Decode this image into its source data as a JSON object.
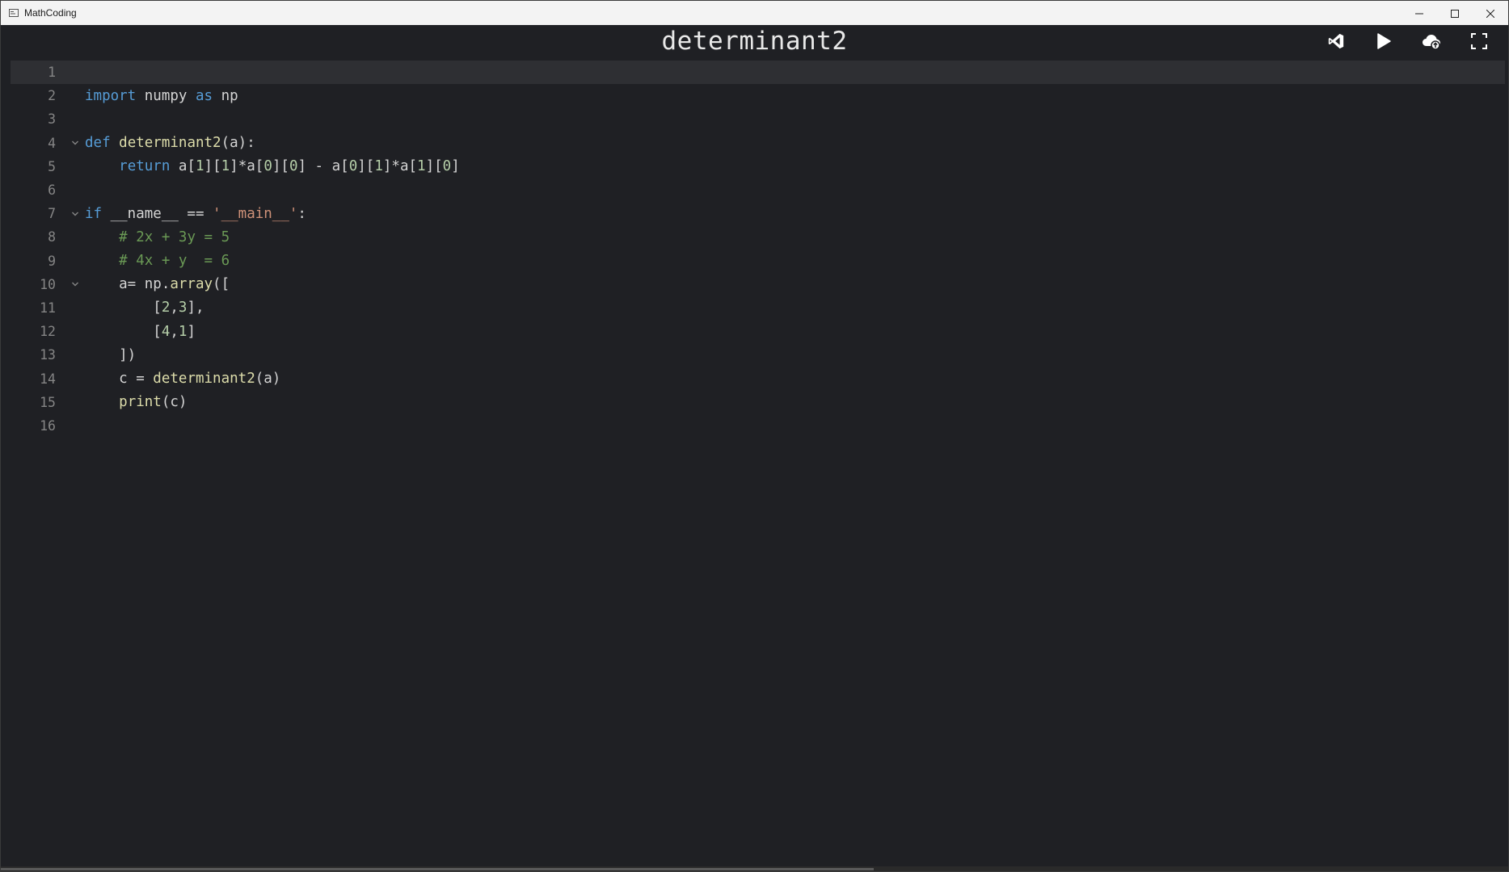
{
  "window": {
    "app_title": "MathCoding",
    "controls": [
      "minimize-icon",
      "maximize-icon",
      "close-icon"
    ]
  },
  "header": {
    "doc_title": "determinant2",
    "tools": [
      {
        "name": "visual-studio-button",
        "icon": "visual-studio-icon"
      },
      {
        "name": "run-button",
        "icon": "play-icon"
      },
      {
        "name": "cloud-upload-button",
        "icon": "cloud-upload-icon"
      },
      {
        "name": "fullscreen-button",
        "icon": "fullscreen-icon"
      }
    ]
  },
  "editor": {
    "active_line": 1,
    "lines": [
      {
        "n": "1",
        "fold": false,
        "tokens": []
      },
      {
        "n": "2",
        "fold": false,
        "tokens": [
          [
            "kw",
            "import"
          ],
          [
            "t",
            " numpy "
          ],
          [
            "kw",
            "as"
          ],
          [
            "t",
            " np"
          ]
        ]
      },
      {
        "n": "3",
        "fold": false,
        "tokens": []
      },
      {
        "n": "4",
        "fold": true,
        "tokens": [
          [
            "kw",
            "def"
          ],
          [
            "t",
            " "
          ],
          [
            "fn",
            "determinant2"
          ],
          [
            "t",
            "(a):"
          ]
        ]
      },
      {
        "n": "5",
        "fold": false,
        "tokens": [
          [
            "t",
            "    "
          ],
          [
            "kw",
            "return"
          ],
          [
            "t",
            " a["
          ],
          [
            "num",
            "1"
          ],
          [
            "t",
            "]["
          ],
          [
            "num",
            "1"
          ],
          [
            "t",
            "]*a["
          ],
          [
            "num",
            "0"
          ],
          [
            "t",
            "]["
          ],
          [
            "num",
            "0"
          ],
          [
            "t",
            "] - a["
          ],
          [
            "num",
            "0"
          ],
          [
            "t",
            "]["
          ],
          [
            "num",
            "1"
          ],
          [
            "t",
            "]*a["
          ],
          [
            "num",
            "1"
          ],
          [
            "t",
            "]["
          ],
          [
            "num",
            "0"
          ],
          [
            "t",
            "]"
          ]
        ]
      },
      {
        "n": "6",
        "fold": false,
        "tokens": []
      },
      {
        "n": "7",
        "fold": true,
        "tokens": [
          [
            "kw",
            "if"
          ],
          [
            "t",
            " __name__ == "
          ],
          [
            "str",
            "'__main__'"
          ],
          [
            "t",
            ":"
          ]
        ]
      },
      {
        "n": "8",
        "fold": false,
        "tokens": [
          [
            "t",
            "    "
          ],
          [
            "cm",
            "# 2x + 3y = 5"
          ]
        ]
      },
      {
        "n": "9",
        "fold": false,
        "tokens": [
          [
            "t",
            "    "
          ],
          [
            "cm",
            "# 4x + y  = 6"
          ]
        ]
      },
      {
        "n": "10",
        "fold": true,
        "tokens": [
          [
            "t",
            "    a= np."
          ],
          [
            "fn",
            "array"
          ],
          [
            "t",
            "(["
          ]
        ]
      },
      {
        "n": "11",
        "fold": false,
        "tokens": [
          [
            "t",
            "        ["
          ],
          [
            "num",
            "2"
          ],
          [
            "t",
            ","
          ],
          [
            "num",
            "3"
          ],
          [
            "t",
            "],"
          ]
        ]
      },
      {
        "n": "12",
        "fold": false,
        "tokens": [
          [
            "t",
            "        ["
          ],
          [
            "num",
            "4"
          ],
          [
            "t",
            ","
          ],
          [
            "num",
            "1"
          ],
          [
            "t",
            "]"
          ]
        ]
      },
      {
        "n": "13",
        "fold": false,
        "tokens": [
          [
            "t",
            "    ])"
          ]
        ]
      },
      {
        "n": "14",
        "fold": false,
        "tokens": [
          [
            "t",
            "    c = "
          ],
          [
            "fn",
            "determinant2"
          ],
          [
            "t",
            "(a)"
          ]
        ]
      },
      {
        "n": "15",
        "fold": false,
        "tokens": [
          [
            "t",
            "    "
          ],
          [
            "fn",
            "print"
          ],
          [
            "t",
            "(c)"
          ]
        ]
      },
      {
        "n": "16",
        "fold": false,
        "tokens": []
      }
    ]
  }
}
